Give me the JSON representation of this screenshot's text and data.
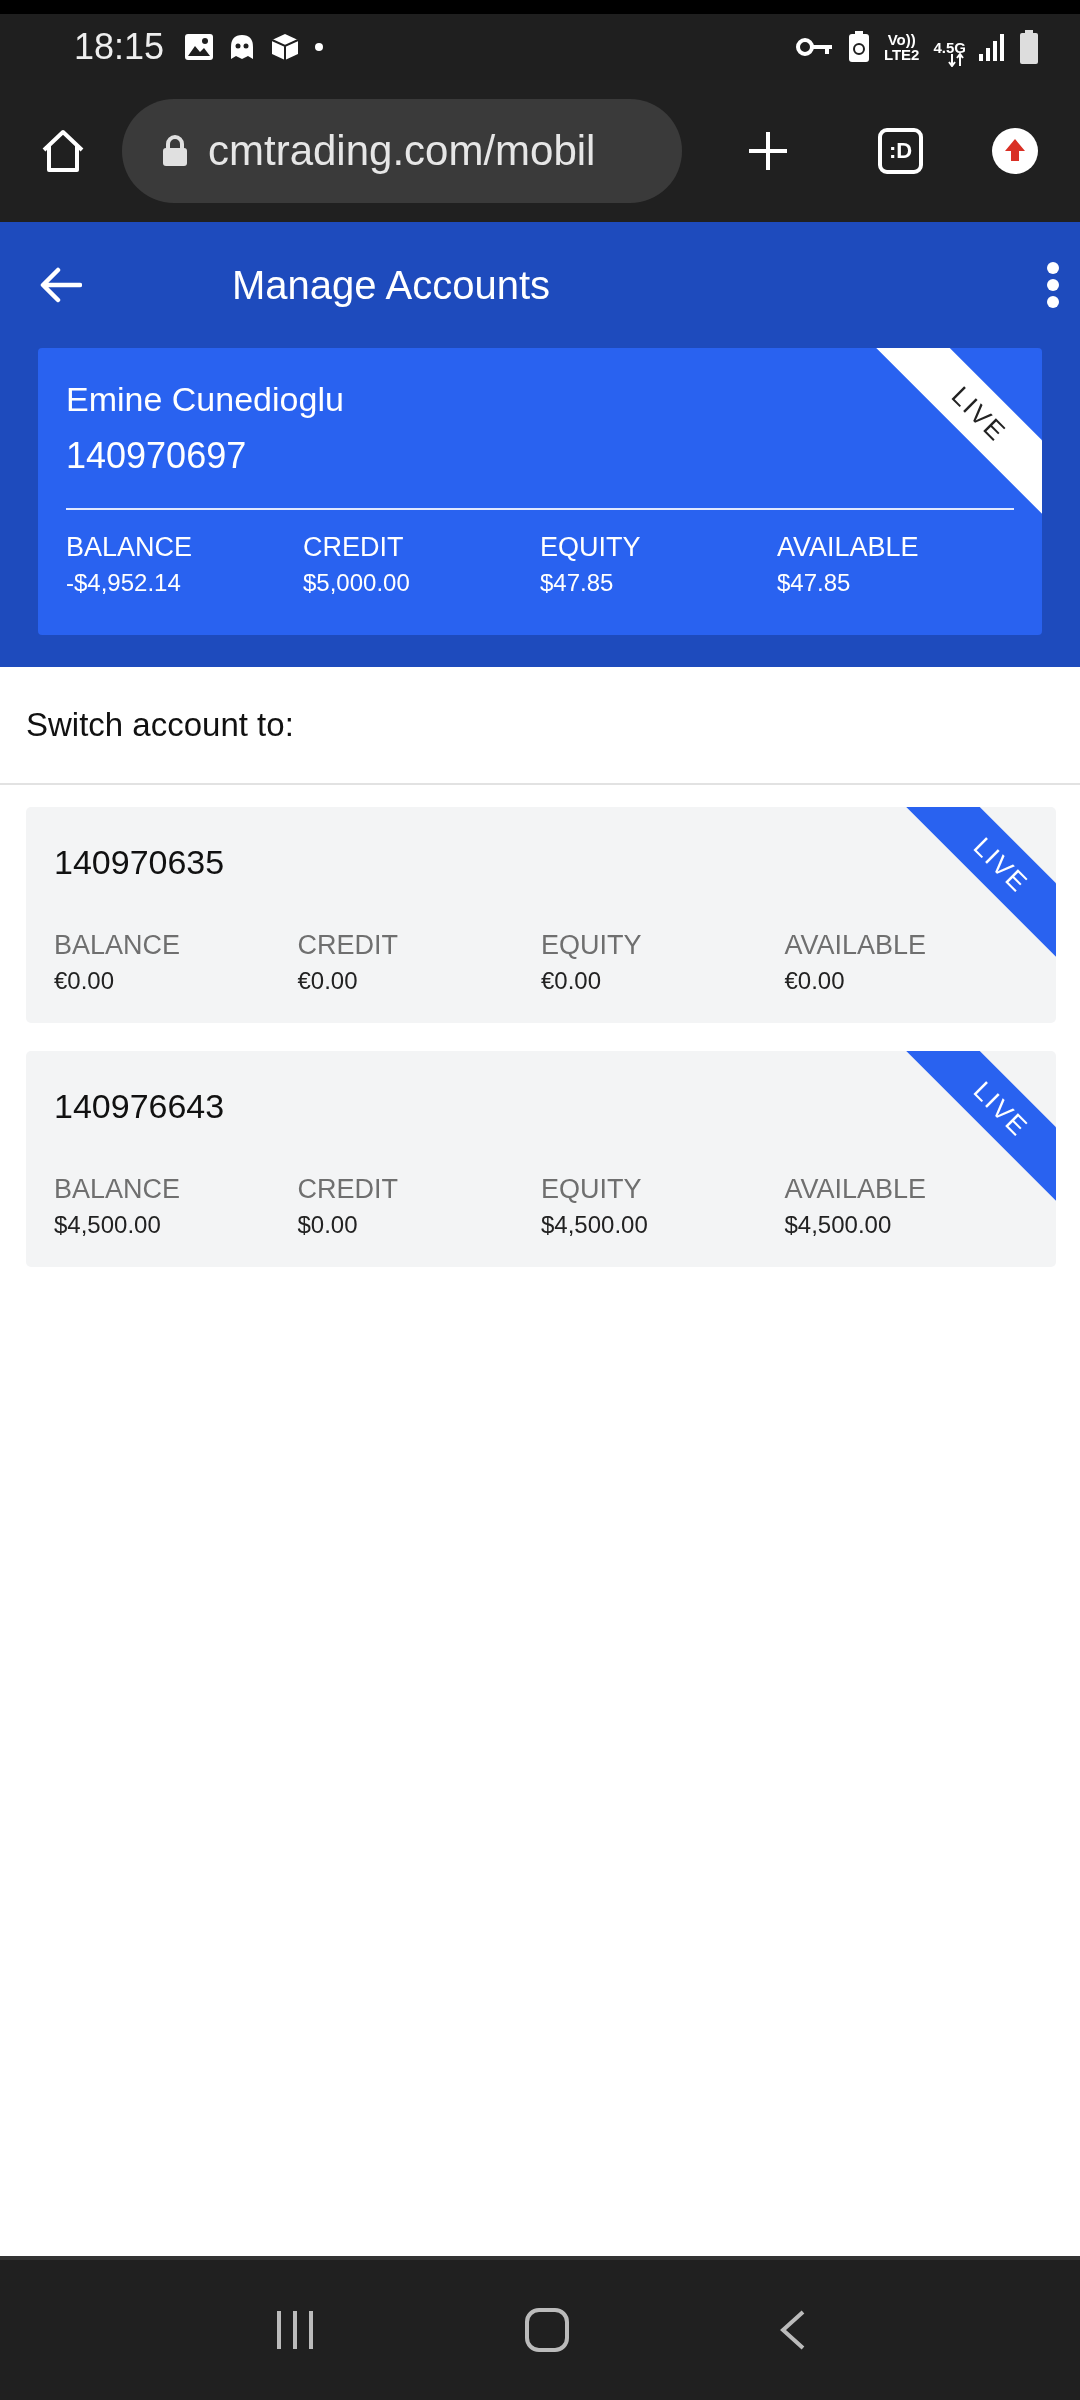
{
  "status_bar": {
    "time": "18:15",
    "network_top": "Vo))",
    "network_bottom": "LTE2",
    "data_type": "4.5G"
  },
  "browser": {
    "url": "cmtrading.com/mobil",
    "tab_button": ":D"
  },
  "header": {
    "title": "Manage Accounts"
  },
  "current_account": {
    "name": "Emine Cunedioglu",
    "number": "140970697",
    "badge": "LIVE",
    "stats": [
      {
        "label": "BALANCE",
        "value": "-$4,952.14"
      },
      {
        "label": "CREDIT",
        "value": "$5,000.00"
      },
      {
        "label": "EQUITY",
        "value": "$47.85"
      },
      {
        "label": "AVAILABLE",
        "value": "$47.85"
      }
    ]
  },
  "switch_label": "Switch account to:",
  "accounts": [
    {
      "number": "140970635",
      "badge": "LIVE",
      "stats": [
        {
          "label": "BALANCE",
          "value": "€0.00"
        },
        {
          "label": "CREDIT",
          "value": "€0.00"
        },
        {
          "label": "EQUITY",
          "value": "€0.00"
        },
        {
          "label": "AVAILABLE",
          "value": "€0.00"
        }
      ]
    },
    {
      "number": "140976643",
      "badge": "LIVE",
      "stats": [
        {
          "label": "BALANCE",
          "value": "$4,500.00"
        },
        {
          "label": "CREDIT",
          "value": "$0.00"
        },
        {
          "label": "EQUITY",
          "value": "$4,500.00"
        },
        {
          "label": "AVAILABLE",
          "value": "$4,500.00"
        }
      ]
    }
  ]
}
